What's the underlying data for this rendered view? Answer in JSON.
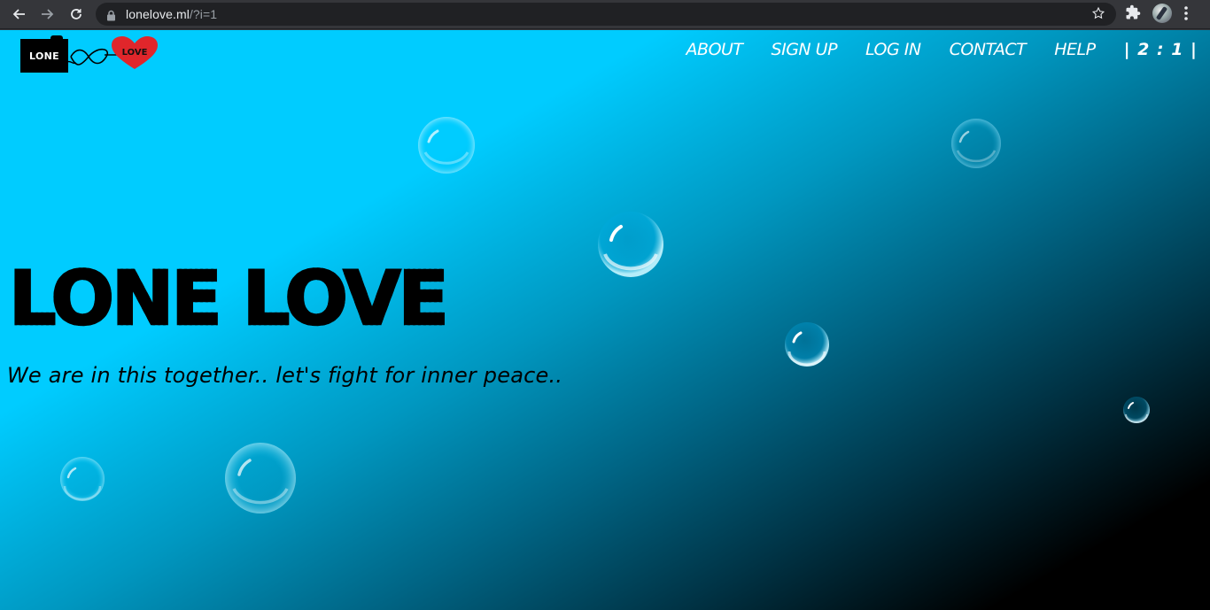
{
  "browser": {
    "url_host": "lonelove.ml",
    "url_path": "/?i=1",
    "icons": [
      "back-arrow-icon",
      "forward-arrow-icon",
      "reload-icon",
      "lock-icon",
      "bookmark-star-icon",
      "extensions-puzzle-icon",
      "profile-avatar",
      "menu-dots-icon"
    ]
  },
  "logo": {
    "lone": "LONE",
    "love": "LOVE"
  },
  "nav": {
    "items": [
      "ABOUT",
      "SIGN UP",
      "LOG IN",
      "CONTACT",
      "HELP"
    ],
    "counter": "| 2 : 1 |"
  },
  "hero": {
    "title": "LONE LOVE",
    "tagline": "We are in this together.. let's fight for inner peace.."
  },
  "colors": {
    "background_top": "#00ccff",
    "background_bottom": "#000000",
    "nav_text": "#ffffff",
    "heart": "#e0262b"
  }
}
